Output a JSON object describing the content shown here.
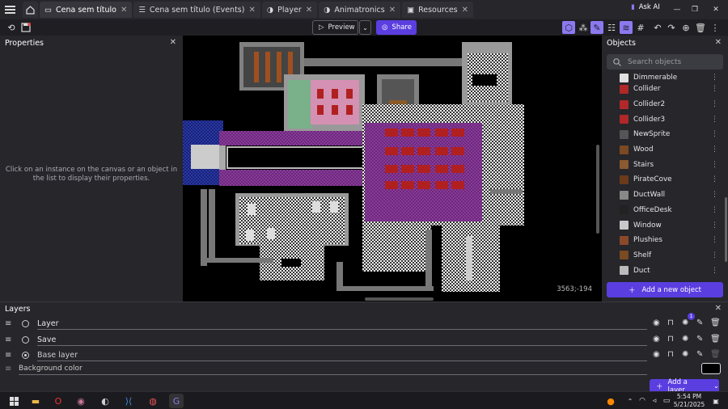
{
  "tabs": [
    {
      "label": "Cena sem título",
      "active": true
    },
    {
      "label": "Cena sem título (Events)",
      "active": false
    },
    {
      "label": "Player",
      "active": false
    },
    {
      "label": "Animatronics",
      "active": false
    },
    {
      "label": "Resources",
      "active": false
    }
  ],
  "askai": "Ask AI",
  "toolbar": {
    "preview": "Preview",
    "share": "Share"
  },
  "properties": {
    "title": "Properties",
    "hint": "Click on an instance on the canvas or an object in the list to display their properties."
  },
  "canvas": {
    "coords": "3563;-194"
  },
  "objects": {
    "title": "Objects",
    "search_placeholder": "Search objects",
    "items": [
      {
        "name": "Dimmerable",
        "color": "#e0e0e0"
      },
      {
        "name": "Collider",
        "color": "#b02828"
      },
      {
        "name": "Collider2",
        "color": "#b02828"
      },
      {
        "name": "Collider3",
        "color": "#b02828"
      },
      {
        "name": "NewSprite",
        "color": "#555555"
      },
      {
        "name": "Wood",
        "color": "#7a4a22"
      },
      {
        "name": "Stairs",
        "color": "#8a5a30"
      },
      {
        "name": "PirateCove",
        "color": "#6a3a1a"
      },
      {
        "name": "DuctWall",
        "color": "#888888"
      },
      {
        "name": "OfficeDesk",
        "color": "#222222"
      },
      {
        "name": "Window",
        "color": "#c8c8c8"
      },
      {
        "name": "Plushies",
        "color": "#8a4a2a"
      },
      {
        "name": "Shelf",
        "color": "#7a4a22"
      },
      {
        "name": "Duct",
        "color": "#bbbbbb"
      }
    ],
    "add_label": "Add a new object"
  },
  "layers": {
    "title": "Layers",
    "rows": [
      {
        "name": "Layer",
        "selected": false,
        "badge": "1"
      },
      {
        "name": "Save",
        "selected": false
      },
      {
        "name": "Base layer",
        "selected": true
      }
    ],
    "background_label": "Background color",
    "add_label": "Add a layer"
  },
  "taskbar": {
    "time": "5:54 PM",
    "date": "5/21/2025"
  },
  "colors": {
    "accent": "#5b3ee0",
    "toggle": "#8b79ef"
  }
}
